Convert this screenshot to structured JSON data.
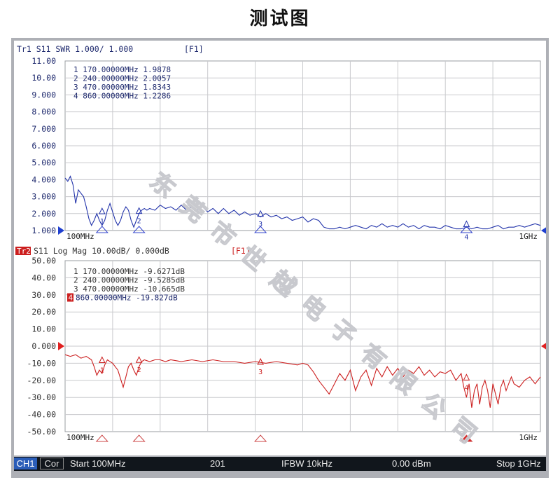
{
  "title": "测试图",
  "watermark": "东莞市世越电子有限公司",
  "status_bar": {
    "channel": "CH1",
    "cor": "Cor",
    "start": "Start 100MHz",
    "points": "201",
    "ifbw": "IFBW 10kHz",
    "power": "0.00 dBm",
    "stop": "Stop 1GHz"
  },
  "colors": {
    "trace1": "#2233aa",
    "trace2": "#cc1f1f",
    "grid": "#c9cacd",
    "axis_text": "#1f2a6e"
  },
  "chart_data": [
    {
      "type": "line",
      "trace_label": "Tr1",
      "header": "Tr1 S11 SWR 1.000/ 1.000",
      "format_tag": "[F1]",
      "x_unit": "MHz",
      "xlim": [
        100,
        1000
      ],
      "ylim": [
        1.0,
        11.0
      ],
      "y_ticks": [
        "11.00",
        "10.00",
        "9.000",
        "8.000",
        "7.000",
        "6.000",
        "5.000",
        "4.000",
        "3.000",
        "2.000",
        "1.000"
      ],
      "x_tick_labels": [
        "100MHz",
        "1GHz"
      ],
      "grid": true,
      "reference_value": 1.0,
      "markers": [
        {
          "id": "1",
          "freq": 170,
          "value": 1.9878,
          "text": "1 170.00000MHz 1.9878"
        },
        {
          "id": "2",
          "freq": 240,
          "value": 2.0057,
          "text": "2 240.00000MHz 2.0057"
        },
        {
          "id": "3",
          "freq": 470,
          "value": 1.8343,
          "text": "3 470.00000MHz 1.8343"
        },
        {
          "id": "4",
          "freq": 860,
          "value": 1.2286,
          "text": "4 860.00000MHz 1.2286"
        }
      ],
      "series": [
        {
          "x": [
            100,
            105,
            110,
            115,
            120,
            125,
            130,
            135,
            140,
            145,
            150,
            155,
            160,
            165,
            170,
            175,
            180,
            185,
            190,
            195,
            200,
            205,
            210,
            215,
            220,
            225,
            230,
            235,
            240,
            245,
            250,
            255,
            260,
            270,
            280,
            290,
            300,
            310,
            320,
            330,
            340,
            350,
            360,
            370,
            380,
            390,
            400,
            410,
            420,
            430,
            440,
            450,
            460,
            470,
            480,
            490,
            500,
            510,
            520,
            530,
            540,
            550,
            560,
            570,
            580,
            590,
            600,
            610,
            620,
            630,
            640,
            650,
            660,
            670,
            680,
            690,
            700,
            710,
            720,
            730,
            740,
            750,
            760,
            770,
            780,
            790,
            800,
            810,
            820,
            830,
            840,
            850,
            860,
            870,
            880,
            890,
            900,
            910,
            920,
            930,
            940,
            950,
            960,
            970,
            980,
            990,
            1000
          ],
          "values": [
            4.1,
            3.9,
            4.2,
            3.7,
            2.6,
            3.4,
            3.2,
            3.0,
            2.4,
            1.7,
            1.3,
            1.6,
            2.0,
            1.6,
            1.3,
            1.6,
            2.2,
            2.6,
            2.1,
            1.6,
            1.3,
            1.6,
            2.1,
            2.4,
            2.2,
            1.6,
            1.2,
            1.6,
            2.0,
            2.2,
            2.3,
            2.2,
            2.3,
            2.2,
            2.5,
            2.3,
            2.4,
            2.2,
            2.5,
            2.2,
            2.4,
            2.2,
            2.4,
            2.1,
            2.3,
            2.0,
            2.3,
            2.0,
            2.2,
            1.9,
            2.1,
            1.9,
            2.0,
            1.8,
            2.0,
            1.8,
            1.9,
            1.7,
            1.8,
            1.6,
            1.7,
            1.8,
            1.5,
            1.7,
            1.6,
            1.2,
            1.1,
            1.1,
            1.2,
            1.1,
            1.2,
            1.3,
            1.2,
            1.1,
            1.3,
            1.2,
            1.4,
            1.2,
            1.3,
            1.2,
            1.4,
            1.2,
            1.3,
            1.1,
            1.3,
            1.2,
            1.2,
            1.1,
            1.3,
            1.2,
            1.1,
            1.1,
            1.2,
            1.1,
            1.2,
            1.1,
            1.1,
            1.2,
            1.3,
            1.1,
            1.2,
            1.2,
            1.3,
            1.2,
            1.3,
            1.4,
            1.3
          ]
        }
      ]
    },
    {
      "type": "line",
      "trace_label": "Tr2",
      "header": "S11 Log Mag 10.00dB/ 0.000dB",
      "format_tag": "[F1]",
      "x_unit": "MHz",
      "xlim": [
        100,
        1000
      ],
      "ylim": [
        -50,
        50
      ],
      "y_ticks": [
        "50.00",
        "40.00",
        "30.00",
        "20.00",
        "10.00",
        "0.000",
        "-10.00",
        "-20.00",
        "-30.00",
        "-40.00",
        "-50.00"
      ],
      "x_tick_labels": [
        "100MHz",
        "1GHz"
      ],
      "grid": true,
      "reference_value": 0,
      "active_marker": "4",
      "markers": [
        {
          "id": "1",
          "freq": 170,
          "value": -9.6271,
          "text": "1 170.00000MHz -9.6271dB"
        },
        {
          "id": "2",
          "freq": 240,
          "value": -9.5285,
          "text": "2 240.00000MHz -9.5285dB"
        },
        {
          "id": "3",
          "freq": 470,
          "value": -10.665,
          "text": "3 470.00000MHz -10.665dB"
        },
        {
          "id": "4",
          "freq": 860,
          "value": -19.827,
          "text": "4 860.00000MHz -19.827dB"
        }
      ],
      "series": [
        {
          "x": [
            100,
            110,
            120,
            130,
            140,
            150,
            155,
            160,
            165,
            170,
            175,
            180,
            190,
            200,
            205,
            210,
            215,
            220,
            225,
            230,
            235,
            240,
            245,
            250,
            260,
            270,
            280,
            290,
            300,
            320,
            340,
            360,
            380,
            400,
            420,
            440,
            460,
            480,
            500,
            520,
            540,
            550,
            560,
            570,
            580,
            590,
            600,
            610,
            620,
            630,
            640,
            650,
            660,
            670,
            680,
            690,
            700,
            710,
            720,
            730,
            740,
            750,
            760,
            770,
            780,
            790,
            800,
            810,
            820,
            830,
            840,
            850,
            855,
            860,
            865,
            870,
            875,
            880,
            885,
            890,
            895,
            900,
            905,
            910,
            915,
            920,
            925,
            930,
            935,
            940,
            945,
            950,
            960,
            970,
            980,
            990,
            1000
          ],
          "values": [
            -5,
            -6,
            -5,
            -7,
            -6,
            -8,
            -12,
            -17,
            -14,
            -16,
            -11,
            -8,
            -10,
            -14,
            -19,
            -24,
            -18,
            -12,
            -10,
            -14,
            -17,
            -12,
            -9,
            -8,
            -9,
            -8,
            -8,
            -9,
            -8,
            -9,
            -8,
            -9,
            -8,
            -9,
            -9,
            -10,
            -9,
            -10,
            -9,
            -10,
            -11,
            -10,
            -11,
            -15,
            -20,
            -24,
            -28,
            -22,
            -16,
            -20,
            -14,
            -26,
            -18,
            -14,
            -23,
            -13,
            -18,
            -12,
            -17,
            -13,
            -18,
            -14,
            -16,
            -12,
            -17,
            -14,
            -18,
            -15,
            -16,
            -14,
            -20,
            -16,
            -24,
            -30,
            -22,
            -36,
            -26,
            -22,
            -34,
            -24,
            -20,
            -26,
            -36,
            -22,
            -28,
            -34,
            -24,
            -20,
            -26,
            -22,
            -18,
            -22,
            -24,
            -20,
            -18,
            -22,
            -18
          ]
        }
      ]
    }
  ]
}
